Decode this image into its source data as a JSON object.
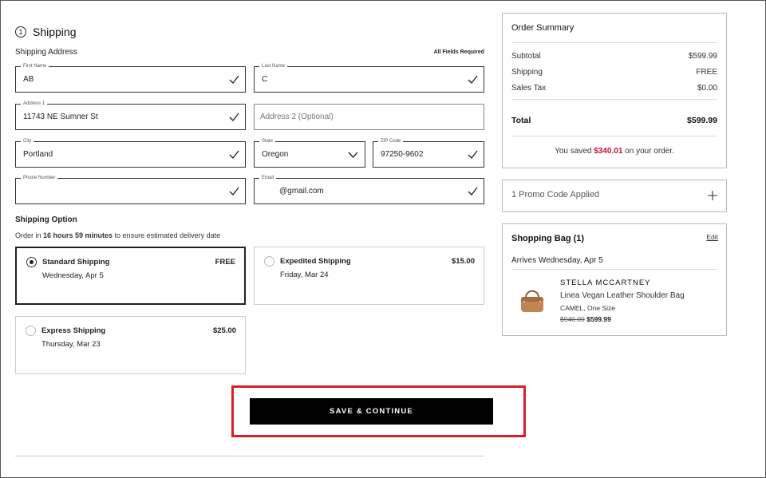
{
  "shipping": {
    "step_number": "1",
    "title": "Shipping",
    "address_label": "Shipping Address",
    "required_note": "All Fields Required",
    "fields": {
      "first_name": {
        "label": "First Name",
        "value": "AB"
      },
      "last_name": {
        "label": "Last Name",
        "value": "C"
      },
      "address1": {
        "label": "Address 1",
        "value": "11743 NE Sumner St"
      },
      "address2": {
        "placeholder": "Address 2 (Optional)"
      },
      "city": {
        "label": "City",
        "value": "Portland"
      },
      "state": {
        "label": "State",
        "value": "Oregon"
      },
      "zip": {
        "label": "ZIP Code",
        "value": "97250-9602"
      },
      "phone": {
        "label": "Phone Number",
        "value": ""
      },
      "email": {
        "label": "Email",
        "value": "@gmail.com"
      }
    },
    "option_label": "Shipping Option",
    "order_note": {
      "prefix": "Order in ",
      "time": "16 hours 59 minutes",
      "suffix": " to ensure estimated delivery date"
    },
    "options": [
      {
        "name": "Standard Shipping",
        "date": "Wednesday, Apr 5",
        "price": "FREE",
        "selected": true
      },
      {
        "name": "Expedited Shipping",
        "date": "Friday, Mar 24",
        "price": "$15.00",
        "selected": false
      },
      {
        "name": "Express Shipping",
        "date": "Thursday, Mar 23",
        "price": "$25.00",
        "selected": false
      }
    ],
    "save_button": "SAVE & CONTINUE"
  },
  "summary": {
    "title": "Order Summary",
    "rows": [
      {
        "label": "Subtotal",
        "value": "$599.99"
      },
      {
        "label": "Shipping",
        "value": "FREE"
      },
      {
        "label": "Sales Tax",
        "value": "$0.00"
      }
    ],
    "total": {
      "label": "Total",
      "value": "$599.99"
    },
    "saved": {
      "prefix": "You saved ",
      "amount": "$340.01",
      "suffix": " on your order."
    }
  },
  "promo": {
    "text": "1 Promo Code Applied"
  },
  "bag": {
    "title": "Shopping Bag (1)",
    "edit": "Edit",
    "arrives": "Arrives Wednesday, Apr 5",
    "item": {
      "brand": "STELLA MCCARTNEY",
      "name": "Linea Vegan Leather Shoulder Bag",
      "variant": "CAMEL, One Size",
      "original_price": "$940.00",
      "sale_price": "$599.99"
    }
  },
  "colors": {
    "highlight": "#d81e28",
    "saved_amount": "#c8102e",
    "button_bg": "#000000"
  }
}
